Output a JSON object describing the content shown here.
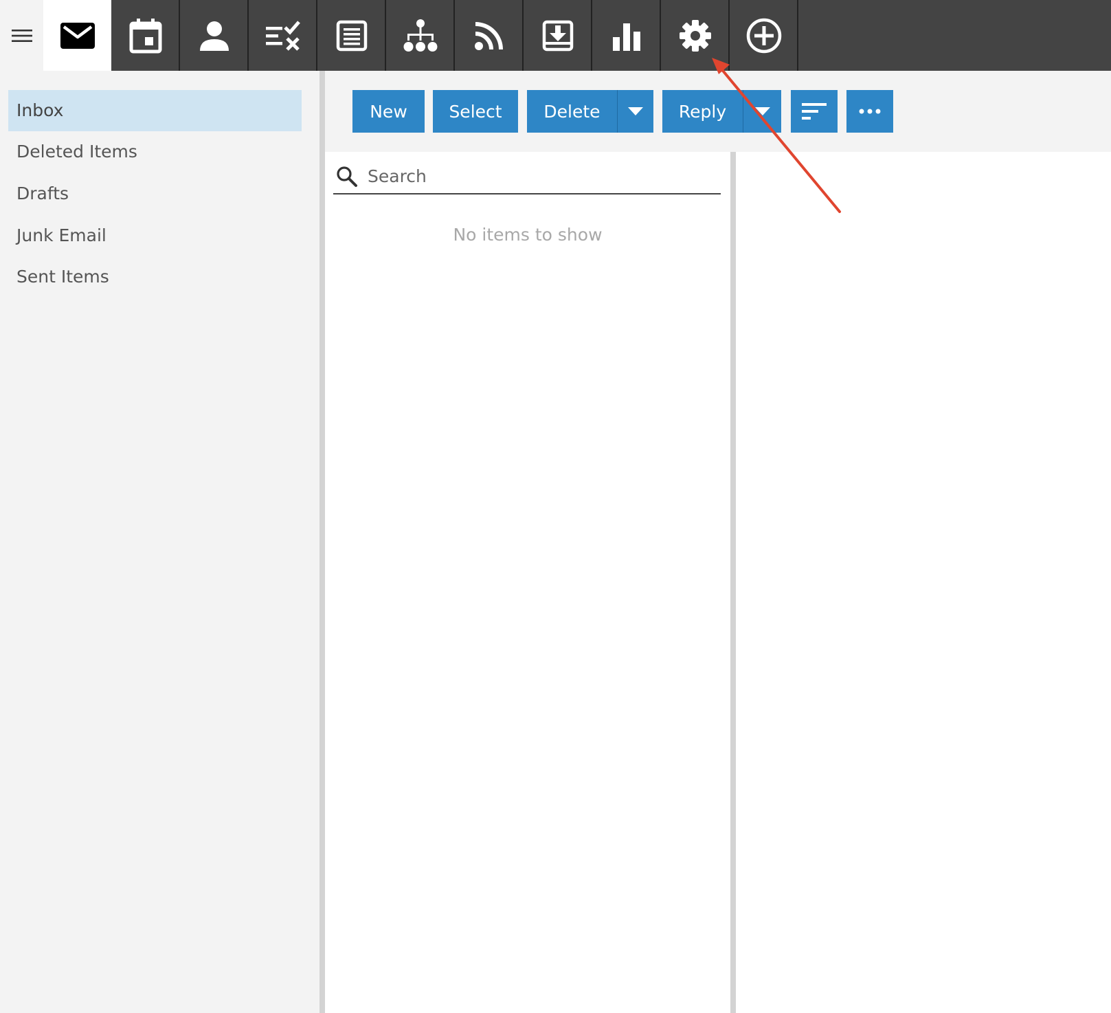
{
  "topbar": {
    "menu_icon": "hamburger-icon",
    "tabs": [
      {
        "name": "mail",
        "icon": "envelope-icon",
        "active": true
      },
      {
        "name": "calendar",
        "icon": "calendar-icon"
      },
      {
        "name": "contacts",
        "icon": "person-icon"
      },
      {
        "name": "tasks",
        "icon": "tasks-check-icon"
      },
      {
        "name": "notes",
        "icon": "notes-icon"
      },
      {
        "name": "org-chart",
        "icon": "hierarchy-icon"
      },
      {
        "name": "rss",
        "icon": "rss-icon"
      },
      {
        "name": "download",
        "icon": "inbox-download-icon"
      },
      {
        "name": "stats",
        "icon": "bar-chart-icon"
      },
      {
        "name": "settings",
        "icon": "gear-icon"
      },
      {
        "name": "add",
        "icon": "plus-circle-icon"
      }
    ]
  },
  "sidebar": {
    "folders": [
      {
        "label": "Inbox",
        "selected": true
      },
      {
        "label": "Deleted Items"
      },
      {
        "label": "Drafts"
      },
      {
        "label": "Junk Email"
      },
      {
        "label": "Sent Items"
      }
    ]
  },
  "toolbar": {
    "new_label": "New",
    "select_label": "Select",
    "delete_label": "Delete",
    "reply_label": "Reply",
    "sort_icon": "sort-lines-icon",
    "more_icon": "ellipsis-icon",
    "dropdown_icon": "caret-down-icon"
  },
  "list": {
    "search_placeholder": "Search",
    "search_value": "",
    "empty_text": "No items to show"
  },
  "colors": {
    "topbar": "#444444",
    "accent": "#2e86c6",
    "selected_folder": "#cfe4f2",
    "annotation_arrow": "#e0452f"
  }
}
